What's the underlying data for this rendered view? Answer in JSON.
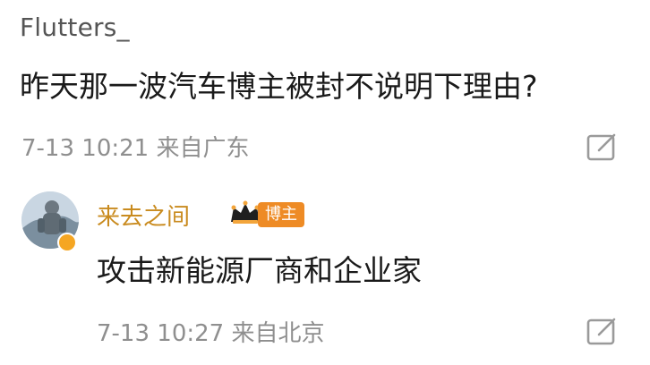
{
  "post": {
    "author": "Flutters_",
    "text": "昨天那一波汽车博主被封不说明下理由?",
    "meta": "7-13 10:21 来自广东",
    "action_icon": "edit-square-icon"
  },
  "reply": {
    "author": "来去之间",
    "badge": "博主",
    "badge_icon": "crown-icon",
    "text": "攻击新能源厂商和企业家",
    "meta": "7-13 10:27 来自北京",
    "action_icon": "edit-square-icon"
  },
  "colors": {
    "author_highlight": "#c98b1f",
    "badge_bg": "#ee8b25",
    "meta_text": "#8f8f8f"
  }
}
